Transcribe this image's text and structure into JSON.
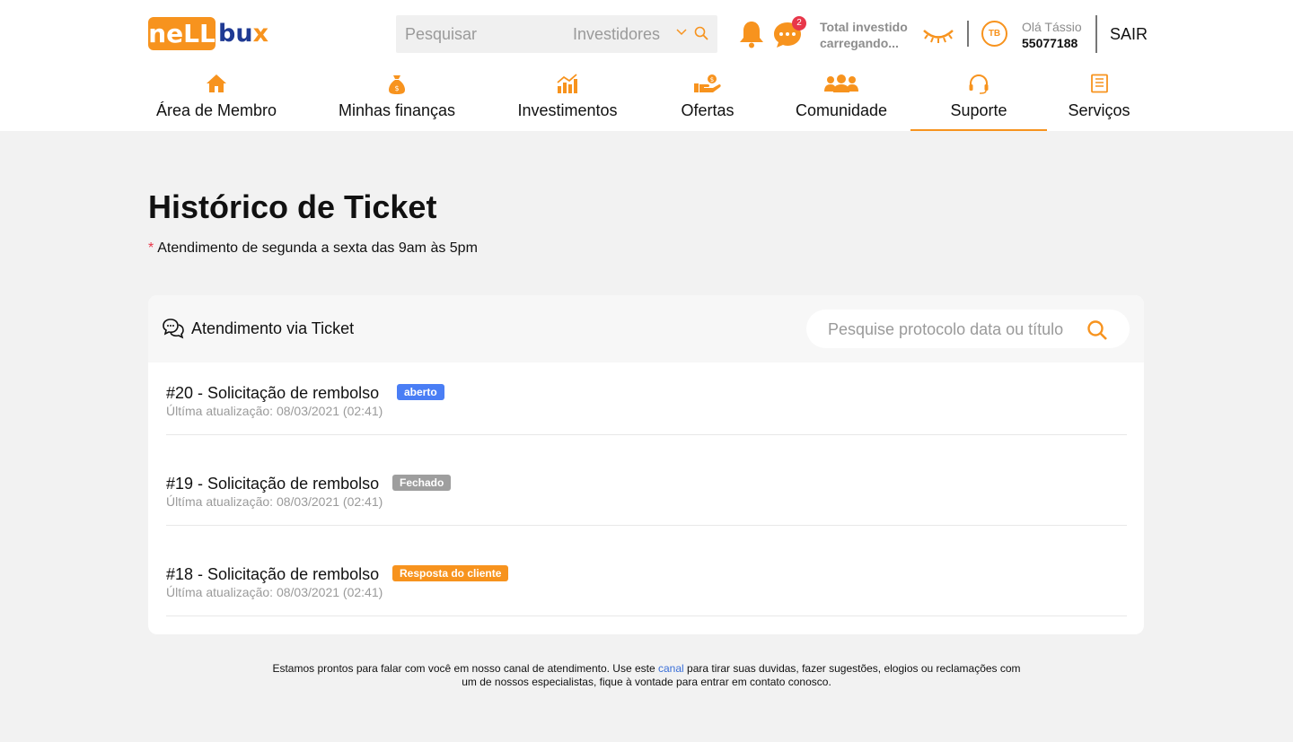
{
  "brand": {
    "logo_box": "neLL",
    "logo_text": "bu",
    "logo_x": "x",
    "primary_color": "#f7931e",
    "secondary_color": "#1f3a93"
  },
  "search": {
    "placeholder": "Pesquisar",
    "filter": "Investidores"
  },
  "notifications": {
    "chat_count": "2"
  },
  "investment": {
    "label": "Total investido",
    "value": "carregando..."
  },
  "user": {
    "initials": "TB",
    "greeting": "Olá Tássio",
    "account": "55077188",
    "logout": "SAIR"
  },
  "nav": {
    "items": [
      {
        "label": "Área de Membro",
        "icon": "home-icon"
      },
      {
        "label": "Minhas finanças",
        "icon": "money-bag-icon"
      },
      {
        "label": "Investimentos",
        "icon": "growth-chart-icon"
      },
      {
        "label": "Ofertas",
        "icon": "hand-coin-icon"
      },
      {
        "label": "Comunidade",
        "icon": "people-icon"
      },
      {
        "label": "Suporte",
        "icon": "headset-icon",
        "active": true
      },
      {
        "label": "Serviços",
        "icon": "document-icon"
      }
    ]
  },
  "page": {
    "title": "Histórico de Ticket",
    "note_star": "*",
    "note": "Atendimento de segunda a sexta das 9am às 5pm"
  },
  "tickets_card": {
    "title": "Atendimento via Ticket",
    "search_placeholder": "Pesquise protocolo data ou título",
    "rows": [
      {
        "title": "#20 - Solicitação de rembolso",
        "status": "aberto",
        "status_color": "#4a7ef5",
        "updated": "Últíma atualização: 08/03/2021 (02:41)"
      },
      {
        "title": "#19 - Solicitação de rembolso",
        "status": "Fechado",
        "status_color": "#9e9e9e",
        "updated": "Últíma atualização: 08/03/2021 (02:41)"
      },
      {
        "title": "#18 - Solicitação de rembolso",
        "status": "Resposta do cliente",
        "status_color": "#f7931e",
        "updated": "Últíma atualização: 08/03/2021 (02:41)"
      }
    ]
  },
  "footer": {
    "before_link": "Estamos prontos para falar com você em nosso canal de atendimento. Use este ",
    "link": "canal",
    "after_link": " para tirar suas duvidas, fazer sugestões, elogios ou reclamações com um de nossos especialistas, fique à vontade para entrar em contato conosco."
  }
}
